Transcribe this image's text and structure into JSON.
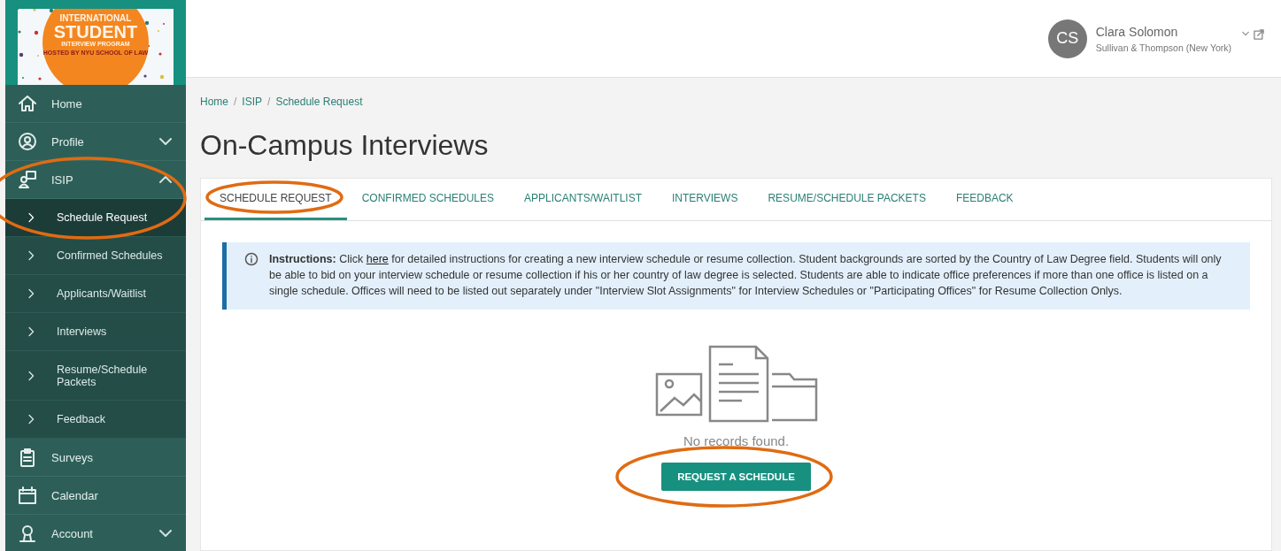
{
  "logo": {
    "lines": [
      "INTERNATIONAL",
      "STUDENT",
      "INTERVIEW PROGRAM",
      "HOSTED BY NYU SCHOOL OF LAW"
    ]
  },
  "sidebar": {
    "items": [
      {
        "label": "Home"
      },
      {
        "label": "Profile",
        "expanded": false
      },
      {
        "label": "ISIP",
        "expanded": true,
        "circled": true,
        "children": [
          {
            "label": "Schedule Request",
            "selected": true
          },
          {
            "label": "Confirmed Schedules",
            "selected": false
          },
          {
            "label": "Applicants/Waitlist",
            "selected": false
          },
          {
            "label": "Interviews",
            "selected": false
          },
          {
            "label": "Resume/Schedule Packets",
            "selected": false
          },
          {
            "label": "Feedback",
            "selected": false
          }
        ]
      },
      {
        "label": "Surveys"
      },
      {
        "label": "Calendar"
      },
      {
        "label": "Account",
        "expanded": false
      }
    ]
  },
  "user": {
    "initials": "CS",
    "name": "Clara Solomon",
    "organization": "Sullivan & Thompson (New York)"
  },
  "breadcrumb": [
    {
      "kind": "link",
      "text": "Home"
    },
    {
      "kind": "separator",
      "text": "/"
    },
    {
      "kind": "link",
      "text": "ISIP"
    },
    {
      "kind": "separator",
      "text": "/"
    },
    {
      "kind": "link",
      "text": "Schedule Request"
    }
  ],
  "page_title": "On-Campus Interviews",
  "tabs": [
    {
      "label": "SCHEDULE REQUEST",
      "selected": true,
      "circled": true
    },
    {
      "label": "CONFIRMED SCHEDULES",
      "selected": false,
      "circled": false
    },
    {
      "label": "APPLICANTS/WAITLIST",
      "selected": false,
      "circled": false
    },
    {
      "label": "INTERVIEWS",
      "selected": false,
      "circled": false
    },
    {
      "label": "RESUME/SCHEDULE PACKETS",
      "selected": false,
      "circled": false
    },
    {
      "label": "FEEDBACK",
      "selected": false,
      "circled": false
    }
  ],
  "instructions": {
    "label": "Instructions:",
    "before_link": "Click ",
    "link": "here",
    "after_link": " for detailed instructions for creating a new interview schedule or resume collection. Student backgrounds are sorted by the Country of Law Degree field. Students will only be able to bid on your interview schedule or resume collection if his or her country of law degree is selected. Students are able to indicate office preferences if more than one office is listed on a single schedule. Offices will need to be listed out separately under \"Interview Slot Assignments\" for Interview Schedules or \"Participating Offices\" for Resume Collection Onlys."
  },
  "empty_state": {
    "message": "No records found.",
    "button": {
      "label": "REQUEST A SCHEDULE",
      "circled": true
    }
  }
}
